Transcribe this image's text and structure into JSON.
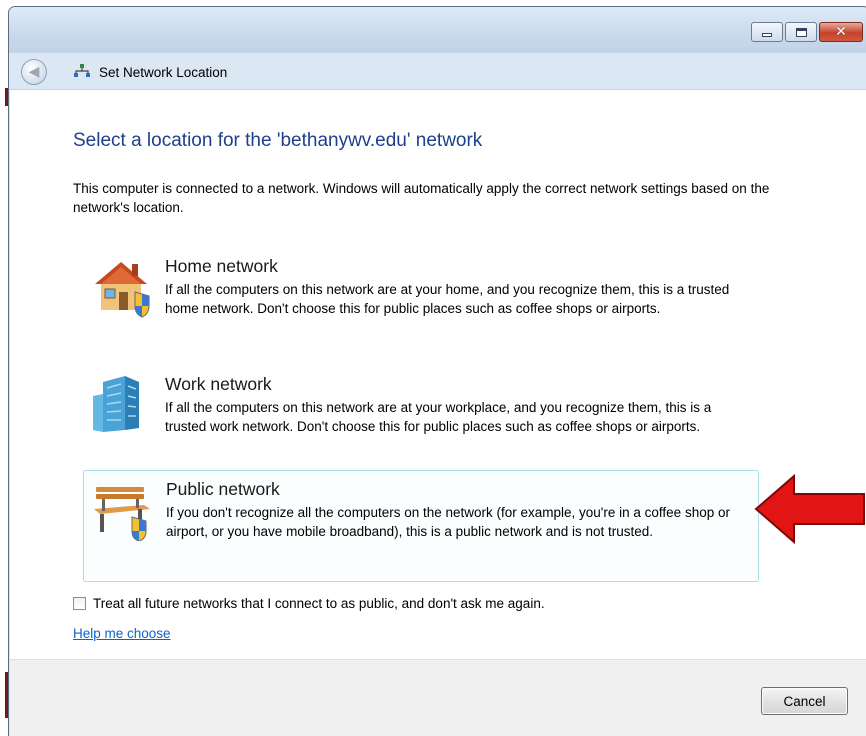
{
  "window": {
    "title": "Set Network Location",
    "controls": {
      "minimize": "minimize",
      "maximize": "maximize",
      "close": "close"
    }
  },
  "main": {
    "heading": "Select a location for the 'bethanywv.edu' network",
    "intro": "This computer is connected to a network. Windows will automatically apply the correct network settings based on the network's location.",
    "options": [
      {
        "title": "Home network",
        "description": "If all the computers on this network are at your home, and you recognize them, this is a trusted home network.  Don't choose this for public places such as coffee shops or airports.",
        "icon": "house-shield-icon",
        "selected": false
      },
      {
        "title": "Work network",
        "description": "If all the computers on this network are at your workplace, and you recognize them, this is a trusted work network.  Don't choose this for public places such as coffee shops or airports.",
        "icon": "office-building-icon",
        "selected": false
      },
      {
        "title": "Public network",
        "description": "If you don't recognize all the computers on the network (for example, you're in a coffee shop or airport, or you have mobile broadband), this is a public network and is not trusted.",
        "icon": "park-bench-shield-icon",
        "selected": true
      }
    ],
    "future_checkbox": {
      "label": "Treat all future networks that I connect to as public, and don't ask me again.",
      "checked": false
    },
    "help_link": "Help me choose"
  },
  "footer": {
    "cancel_label": "Cancel"
  },
  "annotation": {
    "arrow_color": "#e31414",
    "points_to": "Public network"
  },
  "colors": {
    "heading": "#1e3f8a",
    "link": "#0d63c9",
    "selected_border": "#a9dde8"
  }
}
